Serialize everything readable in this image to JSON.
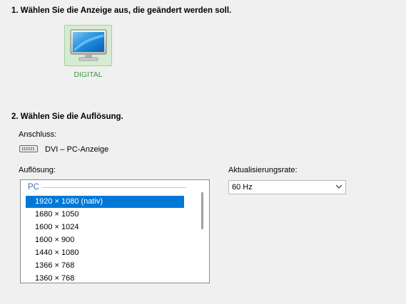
{
  "step1": {
    "heading": "1. Wählen Sie die Anzeige aus, die geändert werden soll.",
    "display": {
      "label": "DIGITAL",
      "icon": "monitor-icon",
      "selected": true
    }
  },
  "step2": {
    "heading": "2. Wählen Sie die Auflösung.",
    "connection": {
      "label": "Anschluss:",
      "icon": "dvi-connector-icon",
      "value": "DVI – PC-Anzeige"
    },
    "resolution": {
      "label": "Auflösung:",
      "group": "PC",
      "items": [
        "1920 × 1080 (nativ)",
        "1680 × 1050",
        "1600 × 1024",
        "1600 × 900",
        "1440 × 1080",
        "1366 × 768",
        "1360 × 768"
      ],
      "selected_index": 0
    },
    "refresh_rate": {
      "label": "Aktualisierungsrate:",
      "selected": "60 Hz",
      "icon": "chevron-down-icon"
    }
  },
  "colors": {
    "accent": "#0078d7",
    "display_tile_bg": "#d6ecd2",
    "display_label": "#3a9a3a",
    "group_header": "#3a6fb4"
  }
}
